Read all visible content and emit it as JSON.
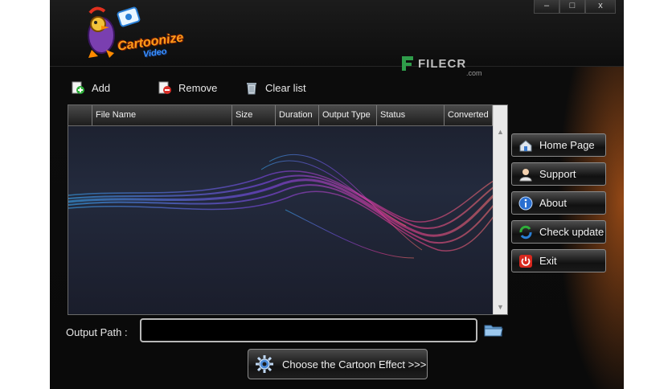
{
  "window": {
    "controls": {
      "minimize": "–",
      "maximize": "□",
      "close": "x"
    },
    "logo": {
      "line1": "Cartoonize",
      "line2": "Video"
    },
    "watermark": {
      "text": "FILECR",
      "suffix": ".com"
    }
  },
  "toolbar": {
    "add_label": "Add",
    "remove_label": "Remove",
    "clear_label": "Clear list",
    "icons": [
      "add-icon",
      "remove-icon",
      "clear-list-icon"
    ]
  },
  "file_table": {
    "columns": [
      "File Name",
      "Size",
      "Duration",
      "Output Type",
      "Status",
      "Converted"
    ],
    "rows": []
  },
  "sidebar": {
    "items": [
      {
        "label": "Home Page",
        "icon": "home-icon"
      },
      {
        "label": "Support",
        "icon": "support-icon"
      },
      {
        "label": "About",
        "icon": "info-icon"
      },
      {
        "label": "Check update",
        "icon": "update-icon"
      },
      {
        "label": "Exit",
        "icon": "power-icon"
      }
    ]
  },
  "output": {
    "label": "Output Path :",
    "value": "",
    "placeholder": "",
    "browse_icon": "folder-icon"
  },
  "effect_button": {
    "label": "Choose the Cartoon Effect >>>",
    "icon": "gear-icon"
  },
  "colors": {
    "background": "#0a0a0a",
    "wave_blue": "#3ab0ff",
    "wave_pink": "#ff3ca0",
    "wave_purple": "#8a4cff",
    "text": "#e8e8e8",
    "logo_orange": "#ff9c1a"
  }
}
